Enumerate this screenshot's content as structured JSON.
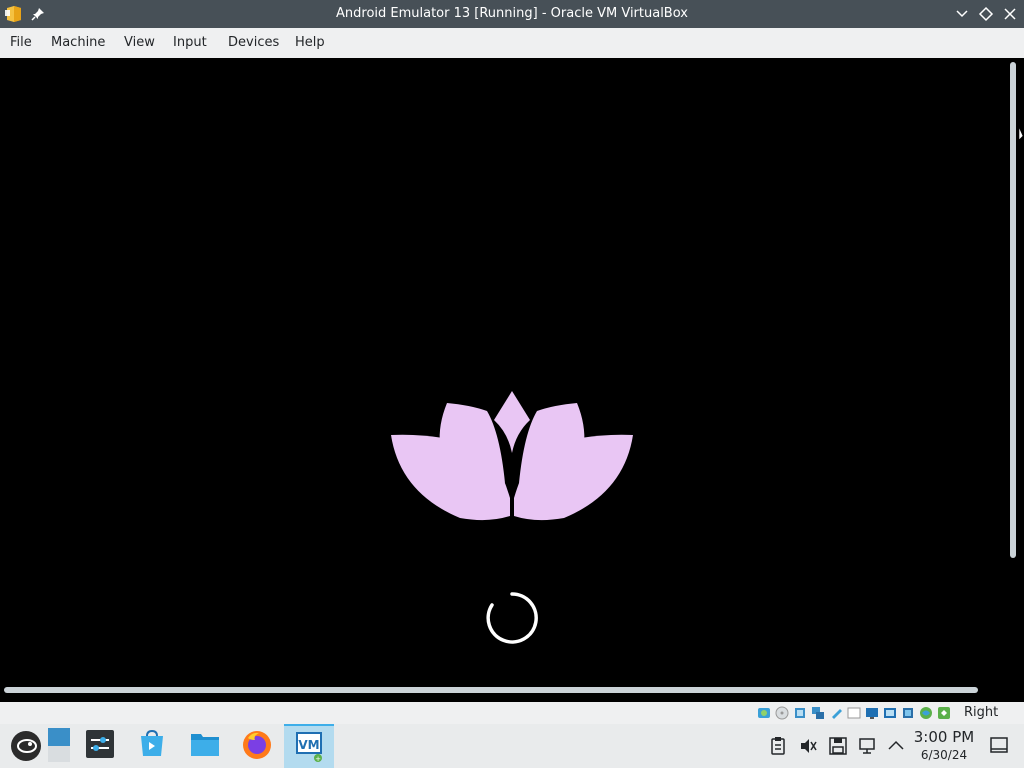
{
  "window": {
    "title": "Android Emulator 13 [Running] - Oracle VM VirtualBox"
  },
  "menubar": {
    "items": [
      "File",
      "Machine",
      "View",
      "Input",
      "Devices",
      "Help"
    ]
  },
  "statusbar": {
    "host_key": "Right Ctrl",
    "icons": [
      "hard-disk-icon",
      "optical-drive-icon",
      "audio-icon",
      "network-icon",
      "usb-icon",
      "shared-folders-icon",
      "display-icon",
      "recording-icon",
      "cpu-icon",
      "mouse-integration-icon",
      "host-key-icon"
    ]
  },
  "taskbar": {
    "apps": [
      "application-launcher-icon",
      "pager-icon",
      "system-settings-icon",
      "discover-icon",
      "file-manager-icon",
      "firefox-icon",
      "virtualbox-icon"
    ],
    "tray": [
      "clipboard-icon",
      "volume-muted-icon",
      "save-icon",
      "network-icon",
      "show-hidden-icon"
    ],
    "clock": {
      "time": "3:00 PM",
      "date": "6/30/24"
    }
  },
  "colors": {
    "titlebar": "#475057",
    "menubar": "#eff0f1",
    "vm_background": "#000000",
    "lotus": "#e9c6f4",
    "taskbar_active": "#b3dbef",
    "accent": "#3daee9"
  }
}
